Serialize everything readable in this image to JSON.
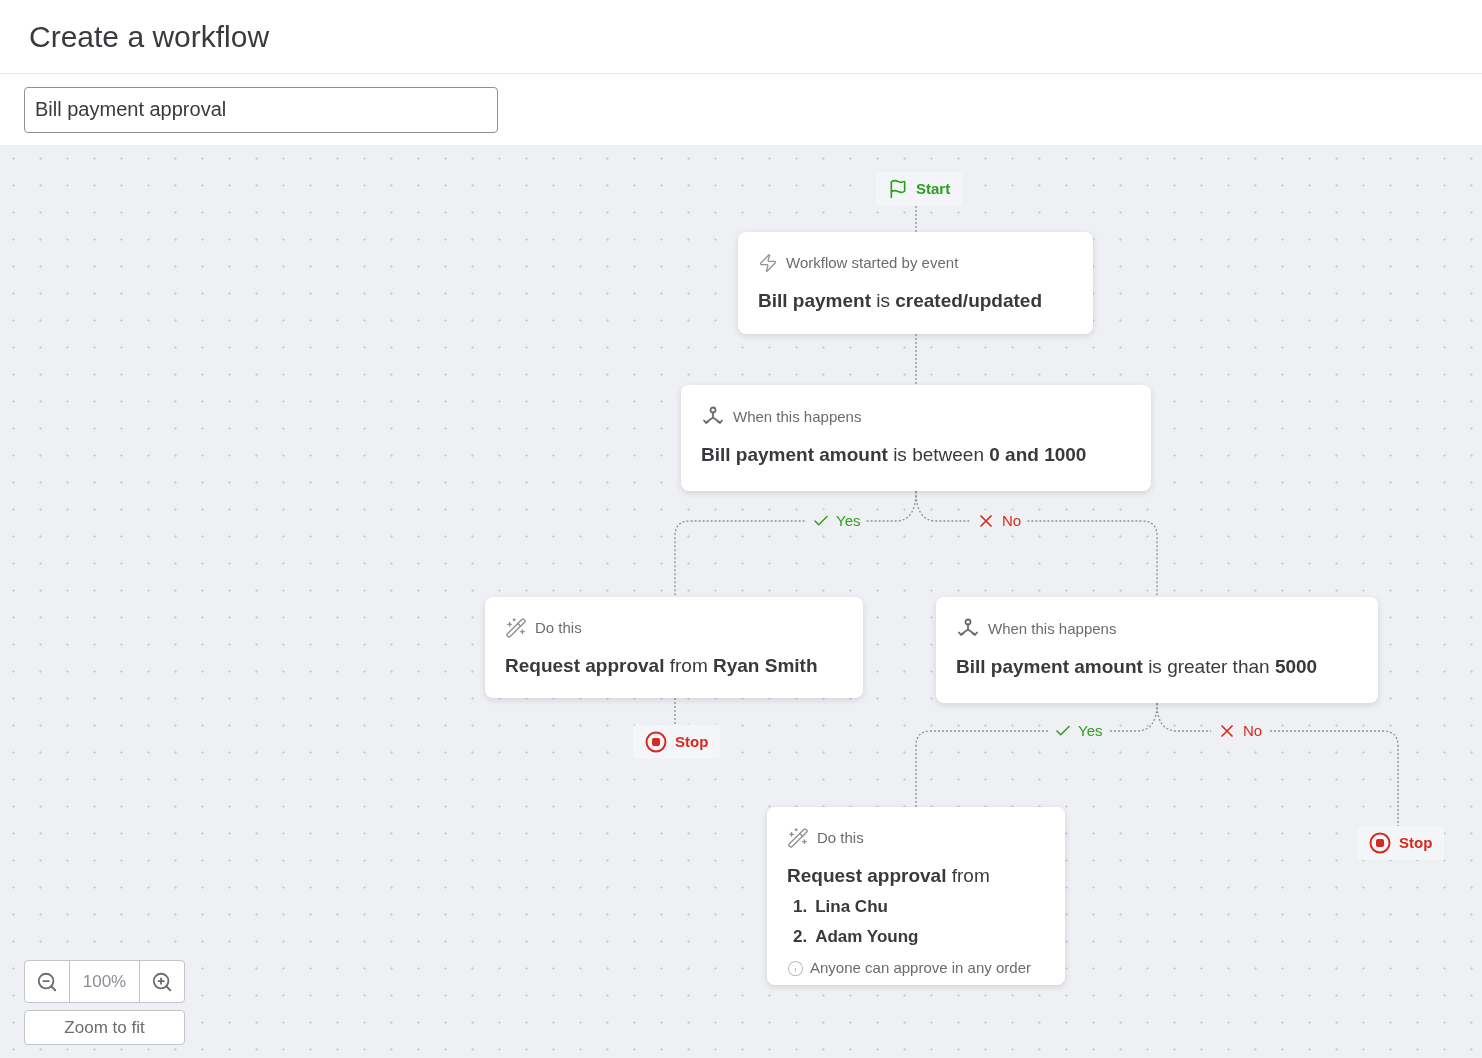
{
  "header": {
    "title": "Create a workflow"
  },
  "name_field": {
    "value": "Bill payment approval"
  },
  "nodes": [
    {
      "kind": "start",
      "label": "Start"
    },
    {
      "kind": "trigger",
      "caption": "Workflow started by event",
      "text": "**Bill payment** is **created/updated**"
    },
    {
      "kind": "condition",
      "caption": "When this happens",
      "text": "**Bill payment amount** is between **0 and 1000**"
    },
    {
      "kind": "action",
      "caption": "Do this",
      "text": "**Request approval** from **Ryan Smith**"
    },
    {
      "kind": "stop",
      "label": "Stop"
    },
    {
      "kind": "condition",
      "caption": "When this happens",
      "text": "**Bill payment amount** is greater than **5000**"
    },
    {
      "kind": "action",
      "caption": "Do this",
      "text": "**Request approval** from",
      "approvers": [
        {
          "number": "1.",
          "name": "Lina Chu"
        },
        {
          "number": "2.",
          "name": "Adam Young"
        }
      ],
      "note": "Anyone can approve in any order"
    },
    {
      "kind": "stop",
      "label": "Stop"
    }
  ],
  "branch_labels": [
    {
      "kind": "yes",
      "label": "Yes"
    },
    {
      "kind": "no",
      "label": "No"
    },
    {
      "kind": "yes",
      "label": "Yes"
    },
    {
      "kind": "no",
      "label": "No"
    }
  ],
  "zoom": {
    "level_text": "100%",
    "fit_button": "Zoom to fit"
  }
}
